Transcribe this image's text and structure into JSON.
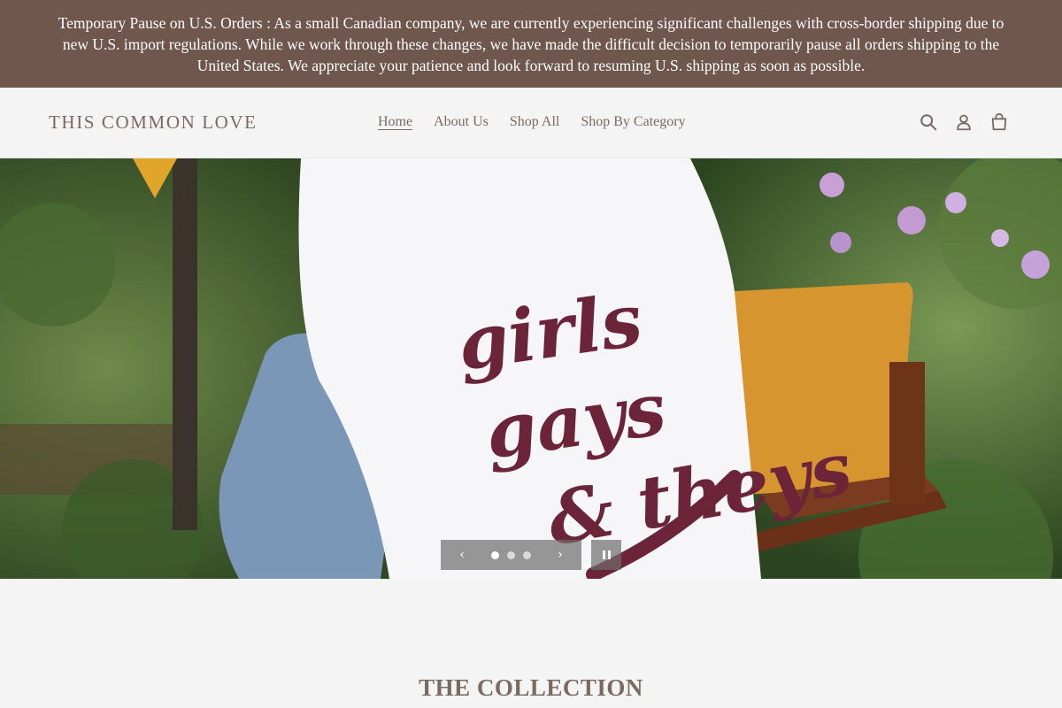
{
  "announcement": {
    "text": "Temporary Pause on U.S. Orders : As a small Canadian company, we are currently experiencing significant challenges with cross-border shipping due to new U.S. import regulations. While we work through these changes, we have made the difficult decision to temporarily pause all orders shipping to the United States. We appreciate your patience and look forward to resuming U.S. shipping as soon as possible."
  },
  "header": {
    "logo": "THIS COMMON LOVE",
    "nav": [
      {
        "label": "Home",
        "active": true
      },
      {
        "label": "About Us",
        "active": false
      },
      {
        "label": "Shop All",
        "active": false
      },
      {
        "label": "Shop By Category",
        "active": false
      }
    ],
    "icons": [
      "search-icon",
      "account-icon",
      "cart-icon"
    ]
  },
  "hero": {
    "shirt_text": [
      "girls",
      "gays",
      "& theys"
    ],
    "slides_count": 3,
    "active_slide": 1,
    "prev_icon": "chevron-left-icon",
    "next_icon": "chevron-right-icon",
    "pause_icon": "pause-icon"
  },
  "collection": {
    "title": "THE COLLECTION"
  },
  "colors": {
    "announcement_bg": "#6f574d",
    "text_brown": "#7b6a62",
    "page_bg": "#f4f4f4",
    "shirt_ink": "#6b2438"
  }
}
